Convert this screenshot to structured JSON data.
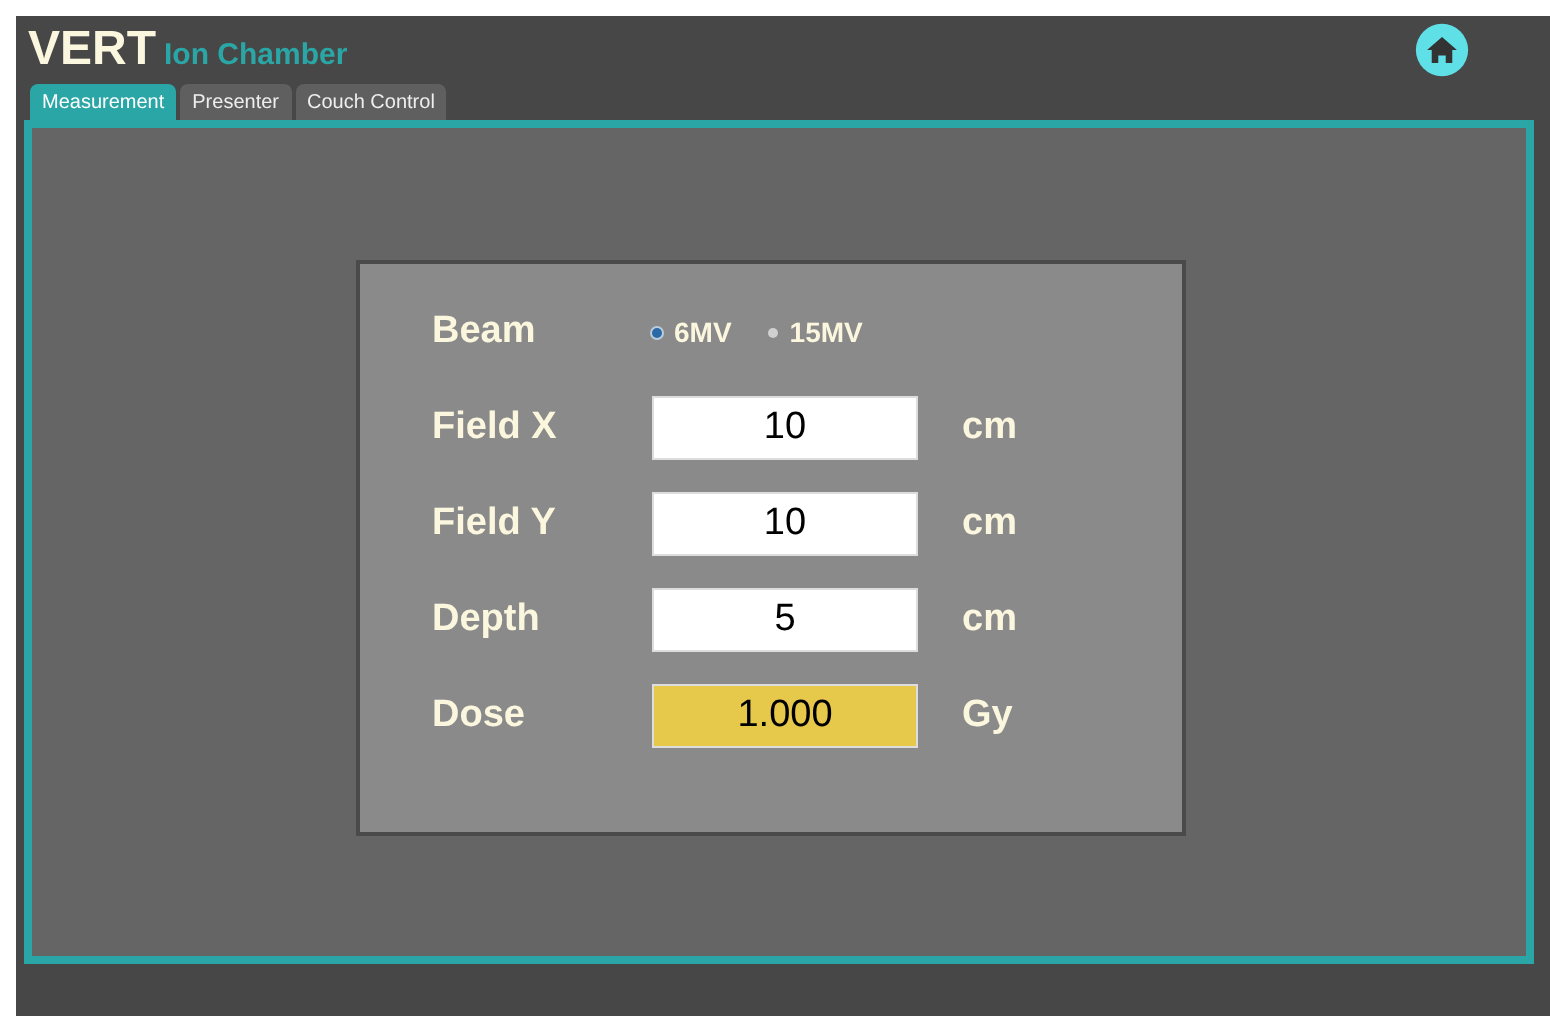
{
  "app": {
    "brand": "VERT",
    "title": "Ion Chamber"
  },
  "tabs": [
    {
      "label": "Measurement",
      "selected": true
    },
    {
      "label": "Presenter",
      "selected": false
    },
    {
      "label": "Couch Control",
      "selected": false
    }
  ],
  "beam": {
    "label": "Beam",
    "options": [
      {
        "label": "6MV",
        "selected": true
      },
      {
        "label": "15MV",
        "selected": false
      }
    ]
  },
  "rows": [
    {
      "label": "Field X",
      "kind": "input",
      "value": "10",
      "unit": "cm"
    },
    {
      "label": "Field Y",
      "kind": "input",
      "value": "10",
      "unit": "cm"
    },
    {
      "label": "Depth",
      "kind": "input",
      "value": "5",
      "unit": "cm"
    },
    {
      "label": "Dose",
      "kind": "output",
      "value": "1.000",
      "unit": "Gy"
    }
  ]
}
